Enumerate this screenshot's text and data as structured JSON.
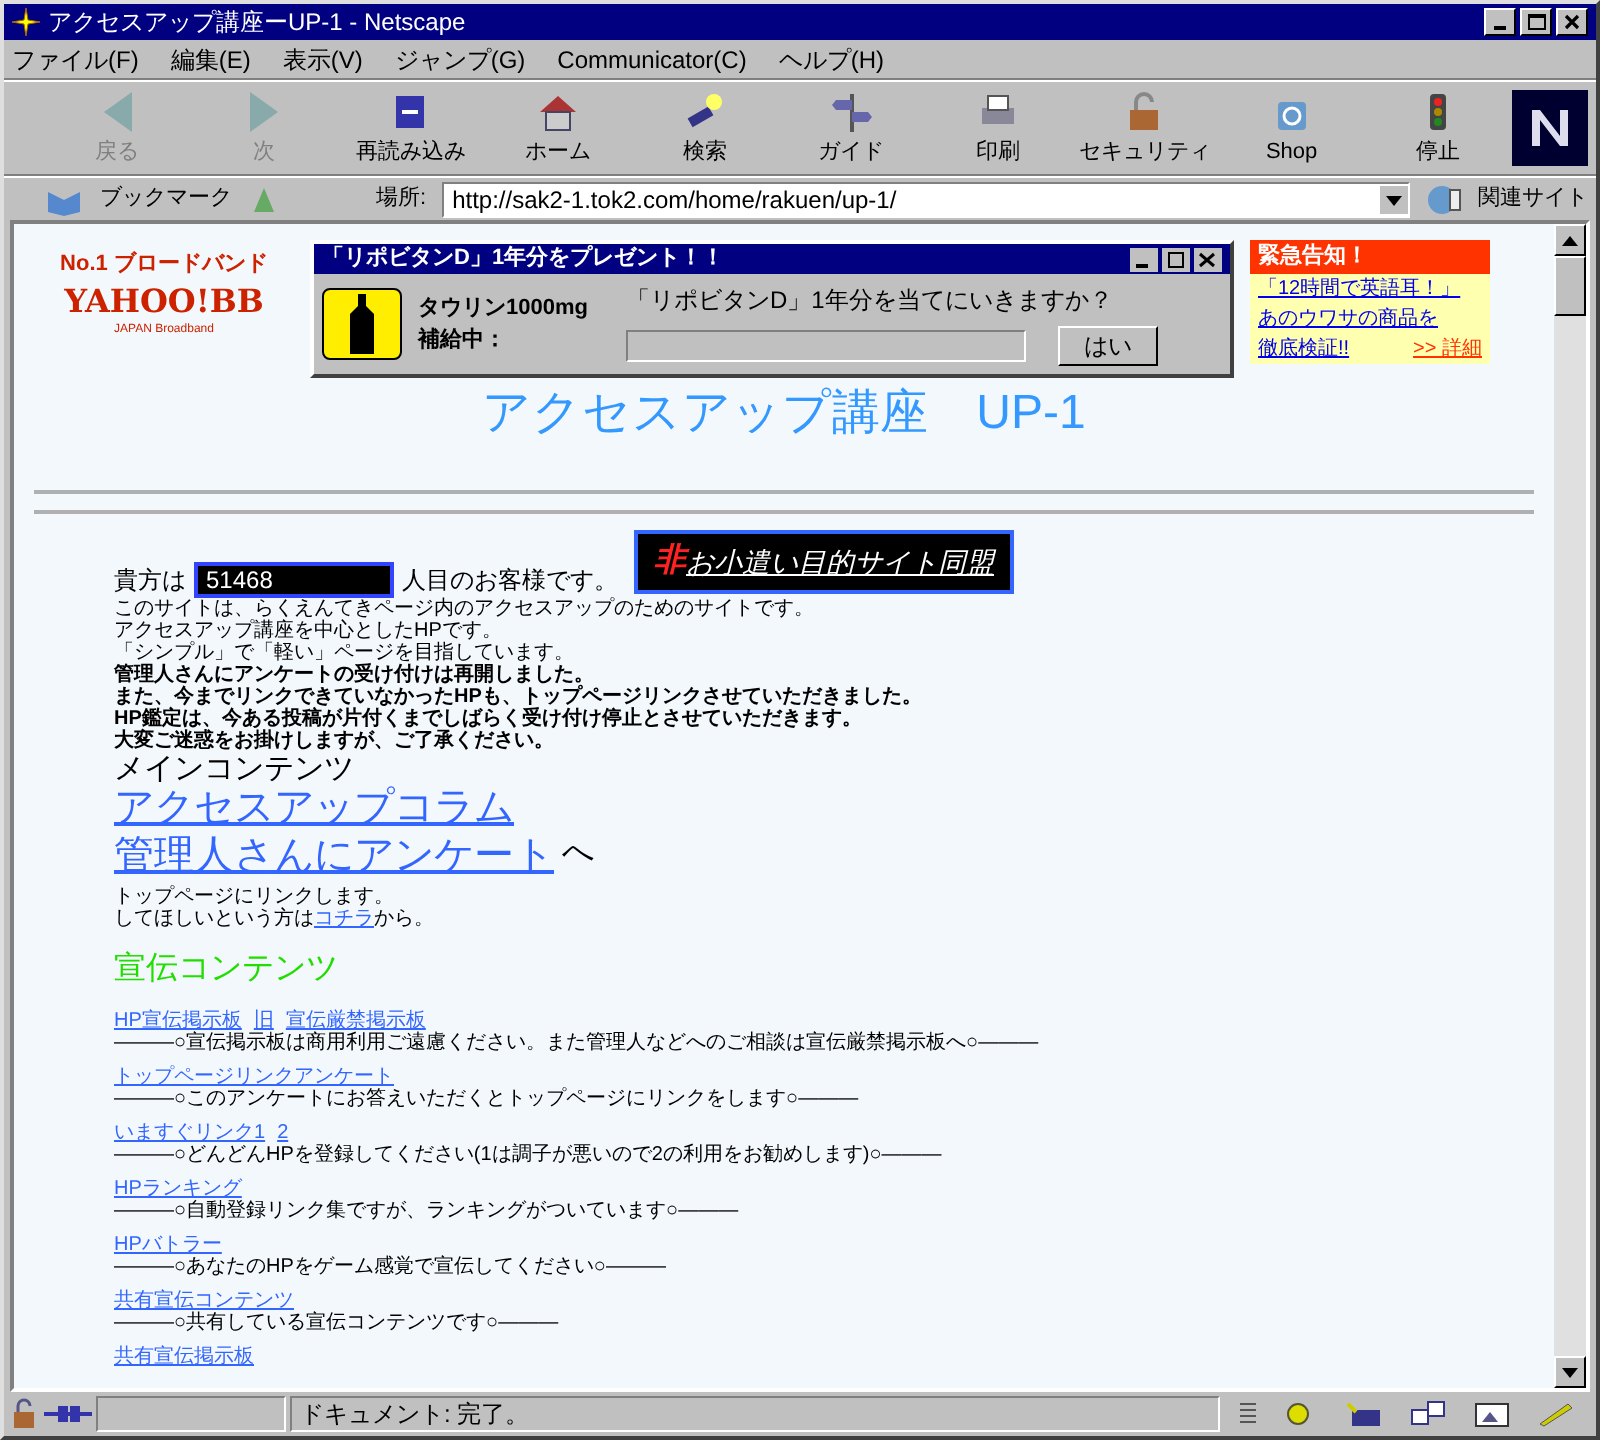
{
  "window": {
    "title": "アクセスアップ講座ーUP-1 - Netscape"
  },
  "menu": [
    "ファイル(F)",
    "編集(E)",
    "表示(V)",
    "ジャンプ(G)",
    "Communicator(C)",
    "ヘルプ(H)"
  ],
  "toolbar": [
    {
      "label": "戻る",
      "kind": "back",
      "disabled": true
    },
    {
      "label": "次",
      "kind": "forward",
      "disabled": true
    },
    {
      "label": "再読み込み",
      "kind": "reload",
      "disabled": false
    },
    {
      "label": "ホーム",
      "kind": "home",
      "disabled": false
    },
    {
      "label": "検索",
      "kind": "search",
      "disabled": false
    },
    {
      "label": "ガイド",
      "kind": "guide",
      "disabled": false
    },
    {
      "label": "印刷",
      "kind": "print",
      "disabled": false
    },
    {
      "label": "セキュリティ",
      "kind": "security",
      "disabled": false
    },
    {
      "label": "Shop",
      "kind": "shop",
      "disabled": false
    },
    {
      "label": "停止",
      "kind": "stop",
      "disabled": false
    }
  ],
  "location_bar": {
    "bookmarks": "ブックマーク",
    "label": "場所:",
    "url": "http://sak2-1.tok2.com/home/rakuen/up-1/",
    "related": "関連サイト"
  },
  "page": {
    "ad_left": {
      "headline": "No.1 ブロードバンド",
      "logo": "YAHOO!BB",
      "logo_sub": "JAPAN Broadband"
    },
    "ad_popup": {
      "title": "「リポビタンD」1年分をプレゼント！！",
      "product": "タウリン1000mg",
      "status": "補給中：",
      "question": "「リポビタンD」1年分を当てにいきますか？",
      "button": "はい"
    },
    "ad_right": {
      "header": "緊急告知！",
      "lines": [
        "「12時間で英語耳！」",
        "あのウワサの商品を",
        "徹底検証!!"
      ],
      "more": ">> 詳細"
    },
    "title": "アクセスアップ講座　UP-1",
    "counter": {
      "before": "貴方は",
      "value": "51468",
      "after": "人目のお客様です。"
    },
    "alliance": {
      "mark": "非",
      "text": "お小遣い目的サイト同盟"
    },
    "intro": [
      {
        "text": "このサイトは、らくえんてきページ内のアクセスアップのためのサイトです。",
        "bold": false
      },
      {
        "text": "アクセスアップ講座を中心としたHPです。",
        "bold": false
      },
      {
        "text": "「シンプル」で「軽い」ページを目指しています。",
        "bold": false
      },
      {
        "text": "管理人さんにアンケートの受け付けは再開しました。",
        "bold": true
      },
      {
        "text": "また、今までリンクできていなかったHPも、トップページリンクさせていただきました。",
        "bold": true
      },
      {
        "text": "HP鑑定は、今ある投稿が片付くまでしばらく受け付け停止とさせていただきます。",
        "bold": true
      },
      {
        "text": "大変ご迷惑をお掛けしますが、ご了承ください。",
        "bold": true
      }
    ],
    "main_heading": "メインコンテンツ",
    "main_links": [
      "アクセスアップコラム",
      "管理人さんにアンケート"
    ],
    "main_suffix": "へ",
    "link_note": {
      "line1": "トップページにリンクします。",
      "before": "してほしいという方は",
      "link": "コチラ",
      "after": "から。"
    },
    "promo_heading": "宣伝コンテンツ",
    "promo": [
      {
        "links": [
          "HP宣伝掲示板",
          "旧",
          "宣伝厳禁掲示板"
        ],
        "description": "———○宣伝掲示板は商用利用ご遠慮ください。また管理人などへのご相談は宣伝厳禁掲示板へ○———"
      },
      {
        "links": [
          "トップページリンクアンケート"
        ],
        "description": "———○このアンケートにお答えいただくとトップページにリンクをします○———"
      },
      {
        "links": [
          "いますぐリンク1",
          "2"
        ],
        "description": "———○どんどんHPを登録してください(1は調子が悪いので2の利用をお勧めします)○———"
      },
      {
        "links": [
          "HPランキング"
        ],
        "description": "———○自動登録リンク集ですが、ランキングがついています○———"
      },
      {
        "links": [
          "HPバトラー"
        ],
        "description": "———○あなたのHPをゲーム感覚で宣伝してください○———"
      },
      {
        "links": [
          "共有宣伝コンテンツ"
        ],
        "description": "———○共有している宣伝コンテンツです○———"
      },
      {
        "links": [
          "共有宣伝掲示板"
        ]
      }
    ]
  },
  "status_bar": {
    "text": "ドキュメント: 完了。"
  }
}
